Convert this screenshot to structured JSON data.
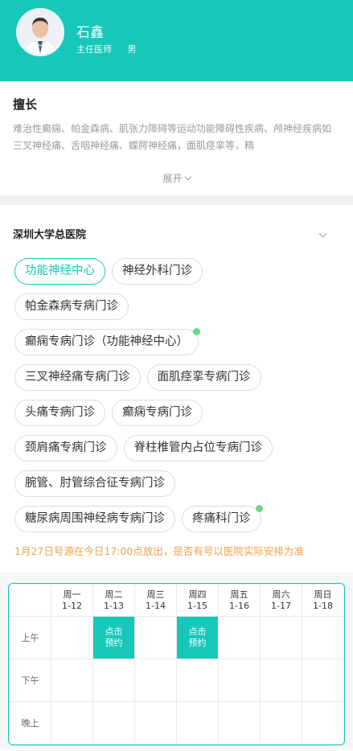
{
  "doctor": {
    "name": "石鑫",
    "title": "主任医师",
    "gender": "男"
  },
  "expertise": {
    "title": "擅长",
    "text": "难治性癫痫、帕金森病、肌张力障碍等运动功能障碍性疾病、颅神经疾病如三叉神经痛、舌咽神经痛、蝶腭神经痛，面肌痉挛等，精",
    "expand_label": "展开"
  },
  "hospital": {
    "name": "深圳大学总医院"
  },
  "departments": [
    {
      "label": "功能神经中心",
      "active": true,
      "dot": false
    },
    {
      "label": "神经外科门诊",
      "active": false,
      "dot": false
    },
    {
      "label": "帕金森病专病门诊",
      "active": false,
      "dot": false
    },
    {
      "label": "癫痫专病门诊（功能神经中心）",
      "active": false,
      "dot": true
    },
    {
      "label": "三叉神经痛专病门诊",
      "active": false,
      "dot": false
    },
    {
      "label": "面肌痉挛专病门诊",
      "active": false,
      "dot": false
    },
    {
      "label": "头痛专病门诊",
      "active": false,
      "dot": false
    },
    {
      "label": "癫痫专病门诊",
      "active": false,
      "dot": false
    },
    {
      "label": "颈肩痛专病门诊",
      "active": false,
      "dot": false
    },
    {
      "label": "脊柱椎管内占位专病门诊",
      "active": false,
      "dot": false
    },
    {
      "label": "腕管、肘管综合征专病门诊",
      "active": false,
      "dot": false
    },
    {
      "label": "糖尿病周围神经病专病门诊",
      "active": false,
      "dot": false
    },
    {
      "label": "疼痛科门诊",
      "active": false,
      "dot": true
    }
  ],
  "notice": "1月27日号源在今日17:00点放出，是否有号以医院实际安排为准",
  "schedule": {
    "days": [
      {
        "weekday": "周一",
        "date": "1-12"
      },
      {
        "weekday": "周二",
        "date": "1-13"
      },
      {
        "weekday": "周三",
        "date": "1-14"
      },
      {
        "weekday": "周四",
        "date": "1-15"
      },
      {
        "weekday": "周五",
        "date": "1-16"
      },
      {
        "weekday": "周六",
        "date": "1-17"
      },
      {
        "weekday": "周日",
        "date": "1-18"
      }
    ],
    "slots": [
      {
        "label": "上午",
        "cells": [
          "",
          "点击\n预约",
          "",
          "点击\n预约",
          "",
          "",
          ""
        ]
      },
      {
        "label": "下午",
        "cells": [
          "",
          "",
          "",
          "",
          "",
          "",
          ""
        ]
      },
      {
        "label": "晚上",
        "cells": [
          "",
          "",
          "",
          "",
          "",
          "",
          ""
        ]
      }
    ]
  },
  "colors": {
    "accent": "#17c7b9",
    "notice": "#f0a24f",
    "dot": "#6fd78b"
  }
}
